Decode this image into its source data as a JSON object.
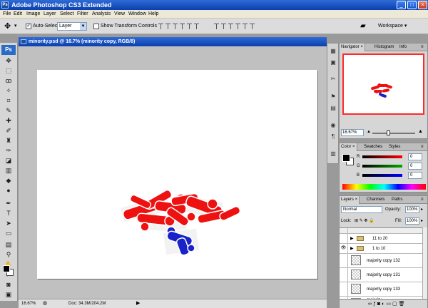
{
  "app": {
    "title": "Adobe Photoshop CS3 Extended",
    "logo": "Ps"
  },
  "menu": [
    "File",
    "Edit",
    "Image",
    "Layer",
    "Select",
    "Filter",
    "Analysis",
    "View",
    "Window",
    "Help"
  ],
  "options": {
    "auto_select_label": "Auto-Select:",
    "auto_select_value": "Layer",
    "show_transform_label": "Show Transform Controls",
    "workspace_label": "Workspace ▾"
  },
  "document": {
    "title": "minority.psd @ 16.7% (minority copy, RGB/8)",
    "zoom": "16.67%",
    "doc_info": "Doc: 34.3M/204.2M"
  },
  "navigator": {
    "tabs": [
      "Navigator ×",
      "Histogram",
      "Info"
    ],
    "zoom": "16.67%"
  },
  "color_panel": {
    "tabs": [
      "Color ×",
      "Swatches",
      "Styles"
    ],
    "channels": [
      {
        "label": "R",
        "value": "0",
        "color": "#ff0000"
      },
      {
        "label": "G",
        "value": "0",
        "color": "#00aa00"
      },
      {
        "label": "B",
        "value": "0",
        "color": "#0000ff"
      }
    ]
  },
  "layers_panel": {
    "tabs": [
      "Layers ×",
      "Channels",
      "Paths"
    ],
    "blend_mode": "Normal",
    "opacity_label": "Opacity:",
    "opacity": "100%",
    "lock_label": "Lock:",
    "fill_label": "Fill:",
    "fill": "100%",
    "layers": [
      {
        "name": "11 to 20",
        "type": "group",
        "visible": false
      },
      {
        "name": "1 to 10",
        "type": "group",
        "visible": true
      },
      {
        "name": "majority copy 132",
        "type": "layer",
        "visible": false
      },
      {
        "name": "majority copy 131",
        "type": "layer",
        "visible": false
      },
      {
        "name": "majority copy 133",
        "type": "layer",
        "visible": false
      },
      {
        "name": "majority",
        "type": "layer",
        "visible": false
      }
    ]
  },
  "colors": {
    "red_figure": "#ee1111",
    "blue_figure": "#1a23c8",
    "accent_border": "#ff2a2a"
  }
}
